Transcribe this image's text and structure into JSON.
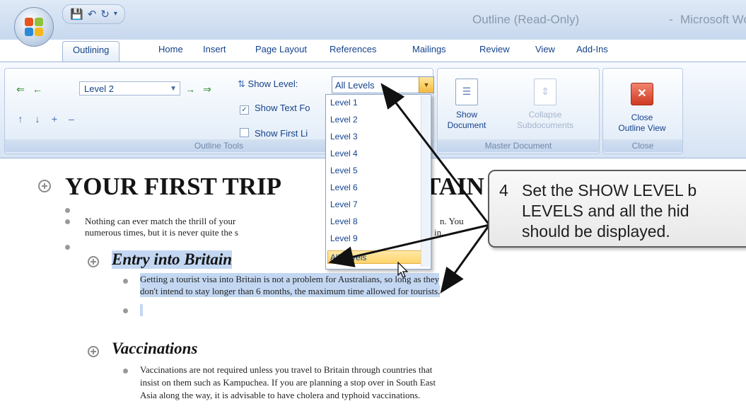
{
  "titlebar": {
    "document_title": "Outline (Read-Only)",
    "separator": "-",
    "app_name": "Microsoft Word"
  },
  "tabs": [
    "Outlining",
    "Home",
    "Insert",
    "Page Layout",
    "References",
    "Mailings",
    "Review",
    "View",
    "Add-Ins"
  ],
  "outline_tools": {
    "level_value": "Level 2",
    "show_level_label": "Show Level:",
    "show_level_value": "All Levels",
    "show_text_formatting": "Show Text Fo",
    "show_first_line": "Show First Li",
    "group_label": "Outline Tools"
  },
  "master_document": {
    "show_document": [
      "Show",
      "Document"
    ],
    "collapse_subdocuments": [
      "Collapse",
      "Subdocuments"
    ],
    "group_label": "Master Document"
  },
  "close_group": {
    "close_outline_view": [
      "Close",
      "Outline View"
    ],
    "group_label": "Close"
  },
  "dropdown": {
    "options": [
      "Level 1",
      "Level 2",
      "Level 3",
      "Level 4",
      "Level 5",
      "Level 6",
      "Level 7",
      "Level 8",
      "Level 9",
      "All Levels"
    ],
    "selected": "All Levels"
  },
  "document": {
    "heading_left": "YOUR FIRST TRIP",
    "heading_right": "TAIN",
    "para1_line1": "Nothing can ever match the thrill of your",
    "para1_line1_tail": "n. You",
    "para1_line2": "numerous times, but it is never quite the s",
    "para1_line2_tail": "in.",
    "sub1": "Entry into Britain",
    "para2_line1": "Getting a tourist visa into Britain is not a problem for Australians, so long as they",
    "para2_line2": "don't intend to stay longer than 6 months, the maximum time allowed for tourists.",
    "sub2": "Vaccinations",
    "para3_line1": "Vaccinations are not required unless you travel to Britain through countries that",
    "para3_line2": "insist on them such as Kampuchea. If you are planning a stop over in South East",
    "para3_line3": "Asia along the way, it is advisable to have cholera and typhoid vaccinations."
  },
  "callout": {
    "number": "4",
    "lines": [
      "Set the SHOW LEVEL b",
      "LEVELS and all the hid",
      "should be displayed."
    ]
  },
  "colors": {
    "ribbon_text": "#15428b",
    "selection": "#c3d7f2",
    "dropdown_highlight": "#fdd46a"
  }
}
